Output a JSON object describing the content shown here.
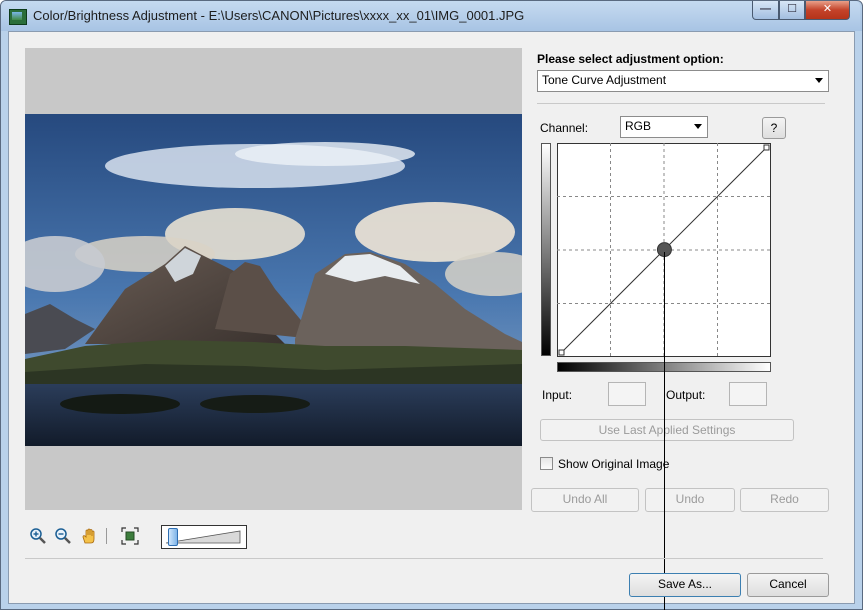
{
  "window": {
    "title": "Color/Brightness Adjustment - E:\\Users\\CANON\\Pictures\\xxxx_xx_01\\IMG_0001.JPG",
    "minimize_label": "—",
    "maximize_label": "☐",
    "close_label": "✕"
  },
  "adjustment": {
    "heading": "Please select adjustment option:",
    "selected_option": "Tone Curve Adjustment"
  },
  "channel": {
    "label": "Channel:",
    "selected": "RGB",
    "help_label": "?"
  },
  "tone_curve": {
    "grid_divisions": 4,
    "control_point": {
      "input": 128,
      "output": 128
    },
    "endpoints": [
      [
        0,
        0
      ],
      [
        255,
        255
      ]
    ]
  },
  "io": {
    "input_label": "Input:",
    "input_value": "",
    "output_label": "Output:",
    "output_value": ""
  },
  "buttons": {
    "use_last": "Use Last Applied Settings",
    "show_original": "Show Original Image",
    "undo_all": "Undo All",
    "undo": "Undo",
    "redo": "Redo",
    "save_as": "Save As...",
    "cancel": "Cancel"
  },
  "toolbar": {
    "zoom_in_icon": "zoom-in-icon",
    "zoom_out_icon": "zoom-out-icon",
    "hand_icon": "hand-icon",
    "fit_icon": "fit-to-window-icon",
    "zoom_level": 0.05
  },
  "colors": {
    "title_bar": "#b9d1ea",
    "close_button": "#c4432a",
    "preview_bg": "#c8c8c8",
    "sky": "#2f5b96",
    "water": "#1c2a40"
  }
}
